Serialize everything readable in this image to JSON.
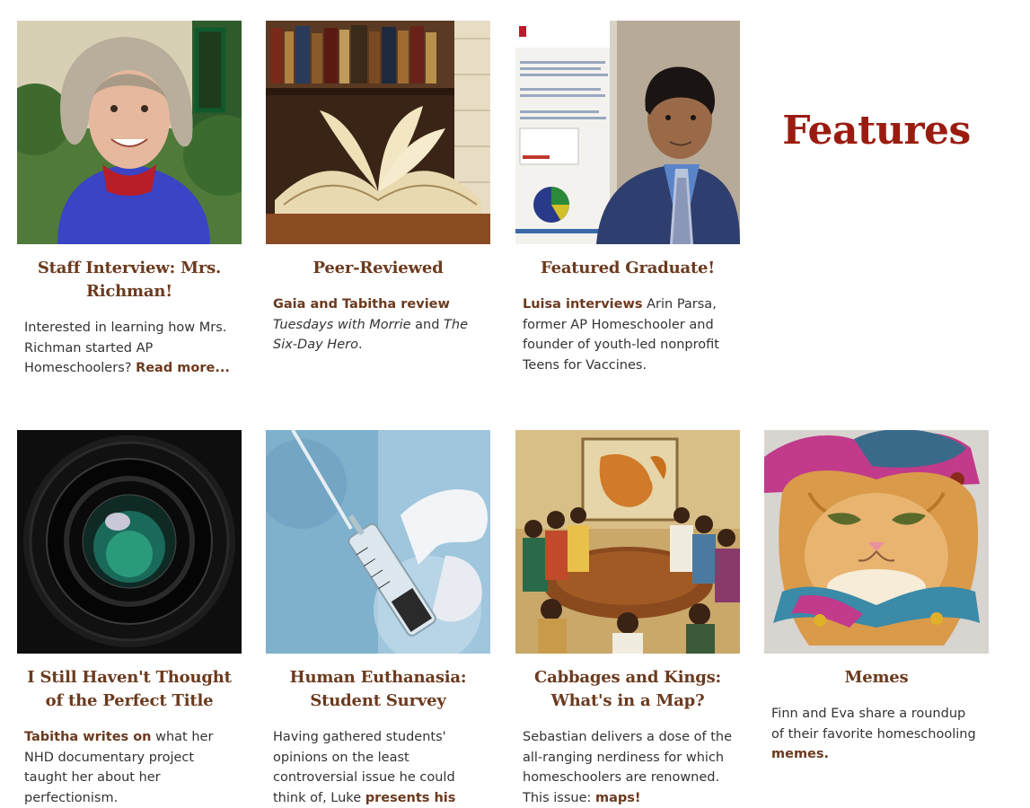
{
  "section_title": "Features",
  "row1": [
    {
      "image": "portrait-woman-blue-sweater",
      "title": "Staff Interview: Mrs. Richman!",
      "desc": {
        "text1": "Interested in learning how Mrs. Richman started AP Homeschoolers? ",
        "link": "Read more..."
      }
    },
    {
      "image": "open-books-library",
      "title": "Peer-Reviewed",
      "desc": {
        "bold": "Gaia and Tabitha review",
        "italic1": "Tuesdays with Morrie",
        "text_and": " and ",
        "italic2": "The Six-Day Hero",
        "text_end": "."
      }
    },
    {
      "image": "graduate-with-poster",
      "title": "Featured Graduate!",
      "desc": {
        "bold": "Luisa interviews",
        "text": " Arin Parsa, former AP Homeschooler and founder of youth-led nonprofit Teens for Vaccines."
      }
    }
  ],
  "row2": [
    {
      "image": "camera-lens",
      "title": "I Still Haven't Thought of the Perfect Title",
      "desc": {
        "bold": "Tabitha writes on",
        "text": " what her NHD documentary project taught her about her perfectionism."
      }
    },
    {
      "image": "syringe-gloved-hand",
      "title": "Human Euthanasia: Student Survey",
      "desc": {
        "text": "Having gathered students' opinions on the least controversial issue he could think of, Luke ",
        "link": "presents his"
      }
    },
    {
      "image": "painting-map-gathering",
      "title": "Cabbages and Kings: What's in a Map?",
      "desc": {
        "text": "Sebastian delivers a dose of the all-ranging nerdiness for which homeschoolers are renowned. This issue: ",
        "link": "maps!"
      }
    },
    {
      "image": "cat-jester-hat",
      "title": "Memes",
      "desc": {
        "text": "Finn and Eva share a roundup of their favorite homeschooling ",
        "link": "memes."
      }
    }
  ],
  "colors": {
    "title": "#6b3a1e",
    "heading": "#9a1c10",
    "text": "#333333"
  }
}
